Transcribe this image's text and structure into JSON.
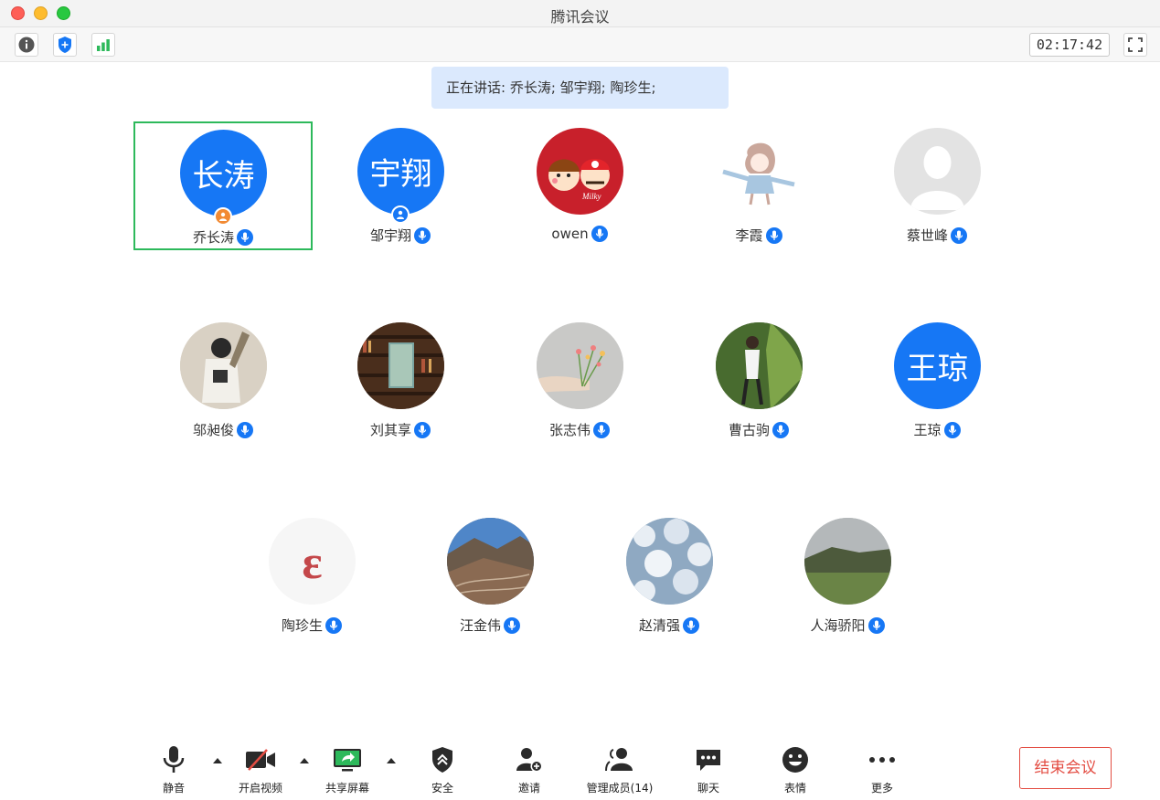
{
  "window": {
    "title": "腾讯会议"
  },
  "toolbar": {
    "timer": "02:17:42"
  },
  "speaking": {
    "text": "正在讲话: 乔长涛; 邹宇翔; 陶珍生;"
  },
  "participants": [
    {
      "name": "乔长涛",
      "avatar_text": "长涛",
      "role": "host",
      "selected": true
    },
    {
      "name": "邹宇翔",
      "avatar_text": "宇翔",
      "role": "cohost"
    },
    {
      "name": "owen",
      "avatar_image": "peko-mario-icon"
    },
    {
      "name": "李霞",
      "avatar_image": "anime-girl-icon"
    },
    {
      "name": "蔡世峰",
      "avatar_image": "default-person-icon"
    },
    {
      "name": "邬昶俊",
      "avatar_image": "figure-photo"
    },
    {
      "name": "刘其享",
      "avatar_image": "bookshelf-photo"
    },
    {
      "name": "张志伟",
      "avatar_image": "flower-hand-photo"
    },
    {
      "name": "曹古驹",
      "avatar_image": "jungle-photo"
    },
    {
      "name": "王琼",
      "avatar_text": "王琼"
    },
    {
      "name": "陶珍生",
      "avatar_image": "epsilon-logo"
    },
    {
      "name": "汪金伟",
      "avatar_image": "mountain-photo"
    },
    {
      "name": "赵清强",
      "avatar_image": "frost-photo"
    },
    {
      "name": "人海骄阳",
      "avatar_image": "grassland-photo"
    }
  ],
  "bottombar": {
    "mute": "静音",
    "video": "开启视频",
    "share": "共享屏幕",
    "security": "安全",
    "invite": "邀请",
    "members": "管理成员(14)",
    "chat": "聊天",
    "reactions": "表情",
    "more": "更多",
    "end": "结束会议"
  },
  "colors": {
    "primary": "#1677f5",
    "selected_border": "#2db95b",
    "end_red": "#e34d43",
    "host_badge": "#f28a33"
  }
}
